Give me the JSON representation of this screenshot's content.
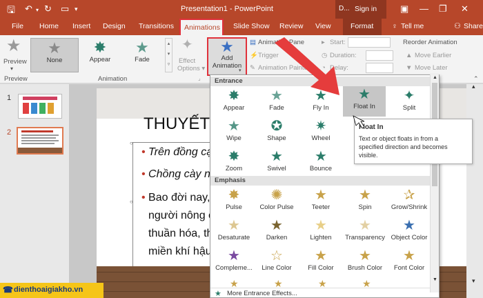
{
  "window": {
    "title": "Presentation1 - PowerPoint",
    "tools_tab": "D...",
    "sign_in": "Sign in"
  },
  "tabs": [
    "File",
    "Home",
    "Insert",
    "Design",
    "Transitions",
    "Animations",
    "Slide Show",
    "Review",
    "View"
  ],
  "tabs_right": {
    "format": "Format",
    "tell_me": "Tell me",
    "share": "Share"
  },
  "ribbon": {
    "preview": "Preview",
    "preview_group": "Preview",
    "gallery": [
      "None",
      "Appear",
      "Fade"
    ],
    "animation_group": "Animation",
    "effect_options": "Effect Options",
    "add_animation_1": "Add",
    "add_animation_2": "Animation",
    "animation_pane": "Animation Pane",
    "trigger": "Trigger",
    "animation_painter": "Animation Painter",
    "start": "Start:",
    "duration": "Duration:",
    "delay": "Delay:",
    "reorder": "Reorder Animation",
    "move_earlier": "Move Earlier",
    "move_later": "Move Later"
  },
  "slides": [
    "1",
    "2"
  ],
  "slide": {
    "title": "THUYẾT",
    "bullets": [
      "Trên đồng cạ",
      "Chồng cày nơ"
    ],
    "body": [
      "Bao đời nay,",
      "người nông c",
      "thuần hóa, th",
      "miền khí hậu"
    ]
  },
  "menu": {
    "entrance_header": "Entrance",
    "entrance": [
      "Appear",
      "Fade",
      "Fly In",
      "Float In",
      "Split",
      "Wipe",
      "Shape",
      "Wheel",
      "Ran",
      "Zoom",
      "Swivel",
      "Bounce"
    ],
    "emphasis_header": "Emphasis",
    "emphasis": [
      "Pulse",
      "Color Pulse",
      "Teeter",
      "Spin",
      "Grow/Shrink",
      "Desaturate",
      "Darken",
      "Lighten",
      "Transparency",
      "Object Color",
      "Compleme...",
      "Line Color",
      "Fill Color",
      "Brush Color",
      "Font Color"
    ],
    "more": "More Entrance Effects..."
  },
  "tooltip": {
    "title": "Float In",
    "body1": "Text or object floats in from a",
    "body2": "specified direction and becomes",
    "body3": "visible."
  },
  "logo": "dienthoaigiakho.vn",
  "colors": {
    "accent": "#b7472a",
    "highlight": "#e0303a",
    "entrance": "#2b7d6a",
    "emphasis": "#c8a24a"
  }
}
